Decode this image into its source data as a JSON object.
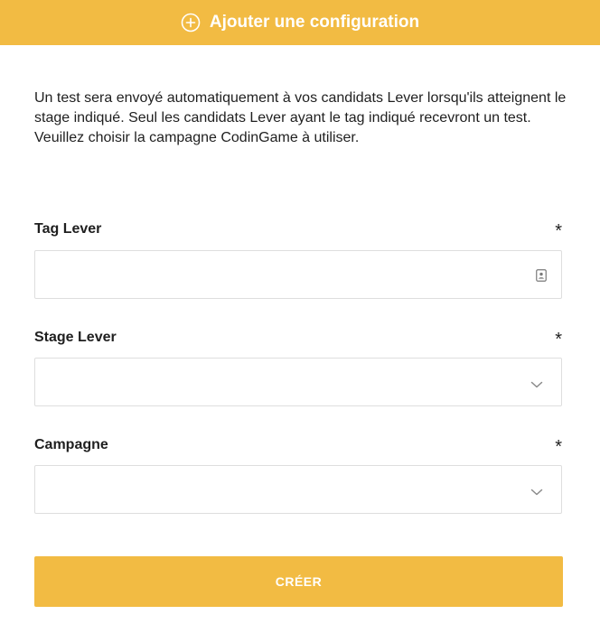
{
  "header": {
    "title": "Ajouter une configuration",
    "icon": "plus-circle-icon",
    "background_color": "#f2bb43",
    "text_color": "#ffffff"
  },
  "description": "Un test sera envoyé automatiquement à vos candidats Lever lorsqu'ils atteignent le stage indiqué. Seul les candidats Lever ayant le tag indiqué recevront un test. Veuillez choisir la campagne CodinGame à utiliser.",
  "form": {
    "required_marker": "*",
    "tag": {
      "label": "Tag Lever",
      "value": "",
      "icon": "contact-card-icon"
    },
    "stage": {
      "label": "Stage Lever",
      "selected": "",
      "icon": "chevron-down-icon"
    },
    "campaign": {
      "label": "Campagne",
      "selected": "",
      "icon": "chevron-down-icon"
    }
  },
  "submit": {
    "label": "CRÉER",
    "background_color": "#f2bb43"
  }
}
